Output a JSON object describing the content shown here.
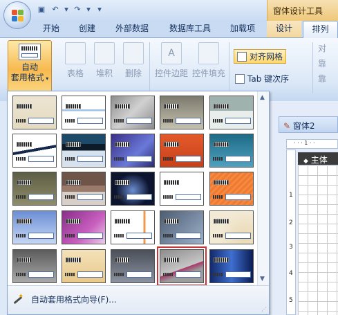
{
  "titlebar": {
    "qat": [
      "save-icon",
      "undo-icon",
      "redo-icon",
      "customize-icon"
    ],
    "context_title": "窗体设计工具"
  },
  "tabs": [
    {
      "label": "开始"
    },
    {
      "label": "创建"
    },
    {
      "label": "外部数据"
    },
    {
      "label": "数据库工具"
    },
    {
      "label": "加载项"
    },
    {
      "label": "设计"
    },
    {
      "label": "排列"
    }
  ],
  "ribbon": {
    "autoformat": {
      "label_line1": "自动",
      "label_line2": "套用格式"
    },
    "layout_buttons": [
      "表格",
      "堆积",
      "删除"
    ],
    "control_buttons": [
      "控件边距",
      "控件填充"
    ],
    "snap_grid": "对齐网格",
    "tab_order": "Tab 键次序",
    "right_cut": [
      "对",
      "靠",
      "靠"
    ]
  },
  "document": {
    "window_title": "窗体2",
    "ruler_marks": "· · · 1 · ·",
    "section": "主体",
    "vruler_numbers": [
      "1",
      "2",
      "3",
      "4",
      "5"
    ]
  },
  "gallery": {
    "footer_label": "自动套用格式向导(F)...",
    "selected_index": 23,
    "styles": [
      {
        "bg": "linear-gradient(#ece5d2,#e3dac0)"
      },
      {
        "bg": "linear-gradient(180deg,#ffffff 0 40%,#9fc1ea 40% 46%,#ffffff 46%)"
      },
      {
        "bg": "linear-gradient(135deg,#8d8d8d,#d1d1d1 50%,#8a8a8a)"
      },
      {
        "bg": "linear-gradient(#7c7a6d,#c3c0ae)"
      },
      {
        "bg": "linear-gradient(180deg,#9fb2ae 0 45%,#e7eeec 45%)"
      },
      {
        "bg": "linear-gradient(170deg,#ffffff 0 45%,#13284b 45% 52%,#ffffff 52%)"
      },
      {
        "bg": "linear-gradient(180deg,#1e4a6a 0 30%,#0d1b28 30% 50%,#d6e3ef 50%)"
      },
      {
        "bg": "linear-gradient(135deg,#3a2f86,#6a79d9 60%,#2c2a70)"
      },
      {
        "bg": "linear-gradient(#e35a2b,#c8401a)"
      },
      {
        "bg": "linear-gradient(#1d6a86,#4fa1bf)"
      },
      {
        "bg": "linear-gradient(#5d5d45,#8e8c6a)"
      },
      {
        "bg": "linear-gradient(180deg,#6f5548 0 40%,#9a7a6b 40% 60%,#d8cfc8 60%)"
      },
      {
        "bg": "radial-gradient(circle at 50% 55%,#6b8ed0,#0d1430 60%)"
      },
      {
        "bg": "linear-gradient(#ffffff,#ffffff)"
      },
      {
        "bg": "repeating-linear-gradient(135deg,#f07a2e 0 3px,#f48a43 3px 6px)"
      },
      {
        "bg": "linear-gradient(#6b8fd6,#c6d7f4)"
      },
      {
        "bg": "linear-gradient(135deg,#8a2d8a,#c85fbf 60%,#ead0e7)"
      },
      {
        "bg": "linear-gradient(90deg,#ffffff 0 75%,#f39a4a 75% 80%,#ffffff 80%)"
      },
      {
        "bg": "linear-gradient(135deg,#4d5d73,#9cb0c9)"
      },
      {
        "bg": "radial-gradient(circle at 80% 80%,#e9d8b3,#f3ead6 60%)"
      },
      {
        "bg": "linear-gradient(#5c5c5c,#a9a9a9)"
      },
      {
        "bg": "linear-gradient(#f4e1b9,#e8c98b)"
      },
      {
        "bg": "linear-gradient(#4a4f59,#8b93a0)"
      },
      {
        "bg": "linear-gradient(160deg,#8c8c8c,#c6c6c6 55%,#a83a6b 56%,#9c9c9c 70%)"
      },
      {
        "bg": "linear-gradient(90deg,#132a6b,#3f6fd0 50%,#0a1c54)"
      }
    ]
  }
}
